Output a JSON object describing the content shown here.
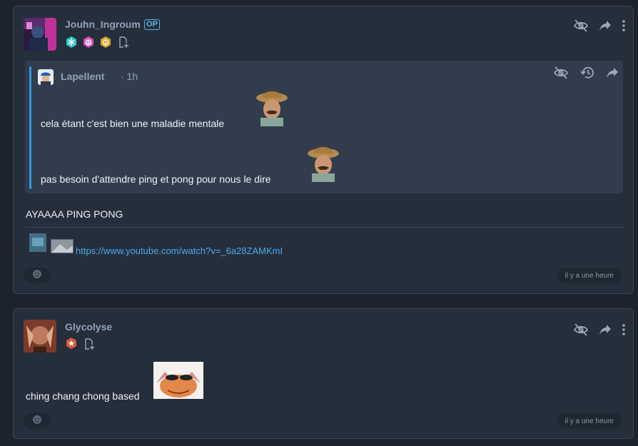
{
  "posts": [
    {
      "author": "Jouhn_Ingroum",
      "op_label": "OP",
      "badges": [
        "snowflake-badge",
        "pink-face-badge",
        "gold-face-badge",
        "file-add-icon"
      ],
      "quote": {
        "author": "Lapellent",
        "time": "· 1h",
        "lines": [
          "cela étant c'est bien une maladie mentale",
          "pas besoin d'attendre ping et pong pour nous le dire"
        ]
      },
      "text": "AYAAAA PING PONG",
      "link": "https://www.youtube.com/watch?v=_6a28ZAMKmI",
      "timestamp": "il y a une heure"
    },
    {
      "author": "Glycolyse",
      "badges": [
        "star-badge",
        "file-add-icon"
      ],
      "text": "ching chang chong based",
      "timestamp": "il y a une heure"
    }
  ],
  "icons": [
    "eye-off-icon",
    "share-icon",
    "more-icon",
    "history-icon",
    "emoji-react-icon"
  ],
  "colors": {
    "background": "#1c232c",
    "card": "#252f3c",
    "quote": "#313d4c",
    "accent": "#2f9ae3",
    "link": "#4aa9f0",
    "username": "#8fa2b9"
  }
}
